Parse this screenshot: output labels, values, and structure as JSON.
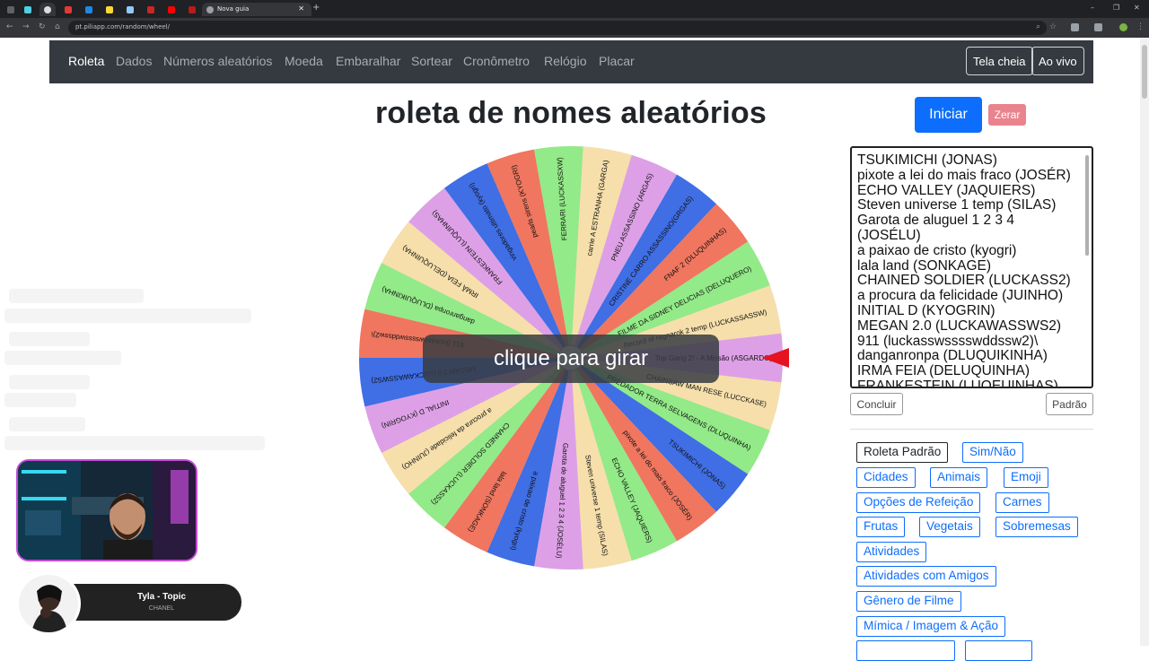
{
  "browser": {
    "tab_title": "Nova guia",
    "url": "pt.piliapp.com/random/wheel/"
  },
  "nav": {
    "items": [
      "Roleta",
      "Dados",
      "Números aleatórios",
      "Moeda",
      "Embaralhar",
      "Sortear",
      "Cronômetro",
      "Relógio",
      "Placar"
    ],
    "fullscreen": "Tela cheia",
    "live": "Ao vivo"
  },
  "page": {
    "title": "roleta de nomes aleatórios",
    "start_button": "Iniciar",
    "reset_button": "Zerar",
    "conclude_button": "Concluir",
    "default_button": "Padrão"
  },
  "names_list": [
    "TSUKIMICHI (JONAS)",
    "pixote a lei do mais fraco (JOSÉR)",
    "ECHO VALLEY (JAQUIERS)",
    "Steven universe 1 temp (SILAS)",
    "Garota de aluguel 1 2 3 4",
    "(JOSÉLU)",
    "a paixao de cristo (kyogri)",
    "lala land (SONKAGE)",
    "CHAINED SOLDIER (LUCKASS2)",
    "a procura da felicidade (JUINHO)",
    "INITIAL D (KYOGRIN)",
    "MEGAN 2.0 (LUCKAWASSWS2)",
    "911 (luckasswsssswddssw2)\\",
    "danganronpa (DLUQUIKINHA)",
    "IRMA FEIA (DELUQUINHA)",
    "FRANKESTEIN (LUQEUINHAS)"
  ],
  "wheel": {
    "overlay_text": "clique para girar",
    "segments": [
      {
        "label": "Top Gang 2! - A Missão (ASGARDO)",
        "color": "#dda0e6"
      },
      {
        "label": "CHAINSAW MAN RESE (LUCCKASE)",
        "color": "#f6dfab"
      },
      {
        "label": "PREDADOR TERRA SELVAGENS (DLUQUINHA)",
        "color": "#93ea88"
      },
      {
        "label": "TSUKIMICHI (JONAS)",
        "color": "#3f6ee5"
      },
      {
        "label": "pixote a lei do mais fraco (JOSÉR)",
        "color": "#f0765f"
      },
      {
        "label": "ECHO VALLEY (JAQUIERS)",
        "color": "#93ea88"
      },
      {
        "label": "Steven universe 1 temp (SILAS)",
        "color": "#f6dfab"
      },
      {
        "label": "Garota de aluguel 1 2 3 4 (JOSÉLU)",
        "color": "#dda0e6"
      },
      {
        "label": "a paixao de cristo (kyogri)",
        "color": "#3f6ee5"
      },
      {
        "label": "lala land (SONKAGE)",
        "color": "#f0765f"
      },
      {
        "label": "CHAINED SOLDIER (LUCKASS2)",
        "color": "#93ea88"
      },
      {
        "label": "a procura da felicidade (JUINHO)",
        "color": "#f6dfab"
      },
      {
        "label": "INITIAL D (KYOGRIN)",
        "color": "#dda0e6"
      },
      {
        "label": "MEGAN 2.0 (LUCKAWASSWS2)",
        "color": "#3f6ee5"
      },
      {
        "label": "911 (luckasswsssswddssw2)\\",
        "color": "#f0765f"
      },
      {
        "label": "danganronpa (DLUQUIKINHA)",
        "color": "#93ea88"
      },
      {
        "label": "IRMÃ FEIA (DELUQUINHA)",
        "color": "#f6dfab"
      },
      {
        "label": "FRANKESTEIN (LUQUINHAS)",
        "color": "#dda0e6"
      },
      {
        "label": "vingadores ultimato (kyogri)",
        "color": "#3f6ee5"
      },
      {
        "label": "pearls sirens (KYOGRI)",
        "color": "#f0765f"
      },
      {
        "label": "FERRARI (LUCKASSXW)",
        "color": "#93ea88"
      },
      {
        "label": "carrie A ESTRANHA (GARGA)",
        "color": "#f6dfab"
      },
      {
        "label": "PNEU ASSASSINO (ARGAS)",
        "color": "#dda0e6"
      },
      {
        "label": "CRISTINE CARRO ASSASSINO(GRGAS)",
        "color": "#3f6ee5"
      },
      {
        "label": "FNAF 2 (DLUQUINHAS)",
        "color": "#f0765f"
      },
      {
        "label": "FILME DA SIDNEY DELICIAS (DELUQUERO)",
        "color": "#93ea88"
      },
      {
        "label": "Record of ragnarok 2 temp (LUCKASSASSW)",
        "color": "#f6dfab"
      }
    ]
  },
  "presets": [
    {
      "label": "Roleta Padrão",
      "active": true
    },
    {
      "label": "Sim/Não",
      "active": false
    },
    {
      "label": "Cidades",
      "active": false
    },
    {
      "label": "Animais",
      "active": false
    },
    {
      "label": "Emoji",
      "active": false
    },
    {
      "label": "Opções de Refeição",
      "active": false
    },
    {
      "label": "Carnes",
      "active": false
    },
    {
      "label": "Frutas",
      "active": false
    },
    {
      "label": "Vegetais",
      "active": false
    },
    {
      "label": "Sobremesas",
      "active": false
    },
    {
      "label": "Atividades",
      "active": false
    },
    {
      "label": "Atividades com Amigos",
      "active": false
    },
    {
      "label": "Gênero de Filme",
      "active": false
    },
    {
      "label": "Mímica / Imagem & Ação",
      "active": false
    }
  ],
  "music": {
    "title": "Tyla - Topic",
    "artist": "CHANEL"
  },
  "colors": {
    "navbar": "#343a40",
    "primary": "#0d6efd",
    "danger_light": "#e9848e",
    "pointer": "#e5121f"
  }
}
